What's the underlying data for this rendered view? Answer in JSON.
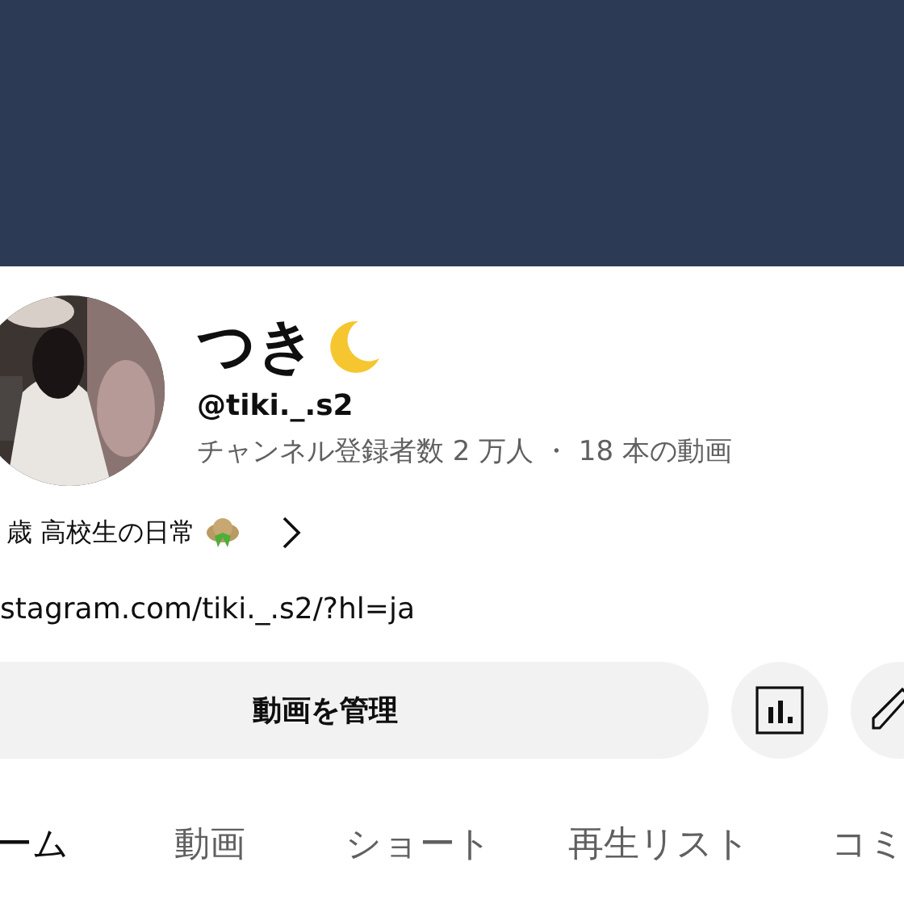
{
  "channel": {
    "name": "つき",
    "handle": "@tiki._.s2",
    "stats": "チャンネル登録者数 2 万人 ・ 18 本の動画",
    "description": "歳 高校生の日常",
    "link": "stagram.com/tiki._.s2/?hl=ja"
  },
  "actions": {
    "manage_button": "動画を管理"
  },
  "tabs": [
    {
      "label": "ーム",
      "selected": true
    },
    {
      "label": "動画",
      "selected": false
    },
    {
      "label": "ショート",
      "selected": false
    },
    {
      "label": "再生リスト",
      "selected": false
    },
    {
      "label": "コミ",
      "selected": false
    }
  ]
}
